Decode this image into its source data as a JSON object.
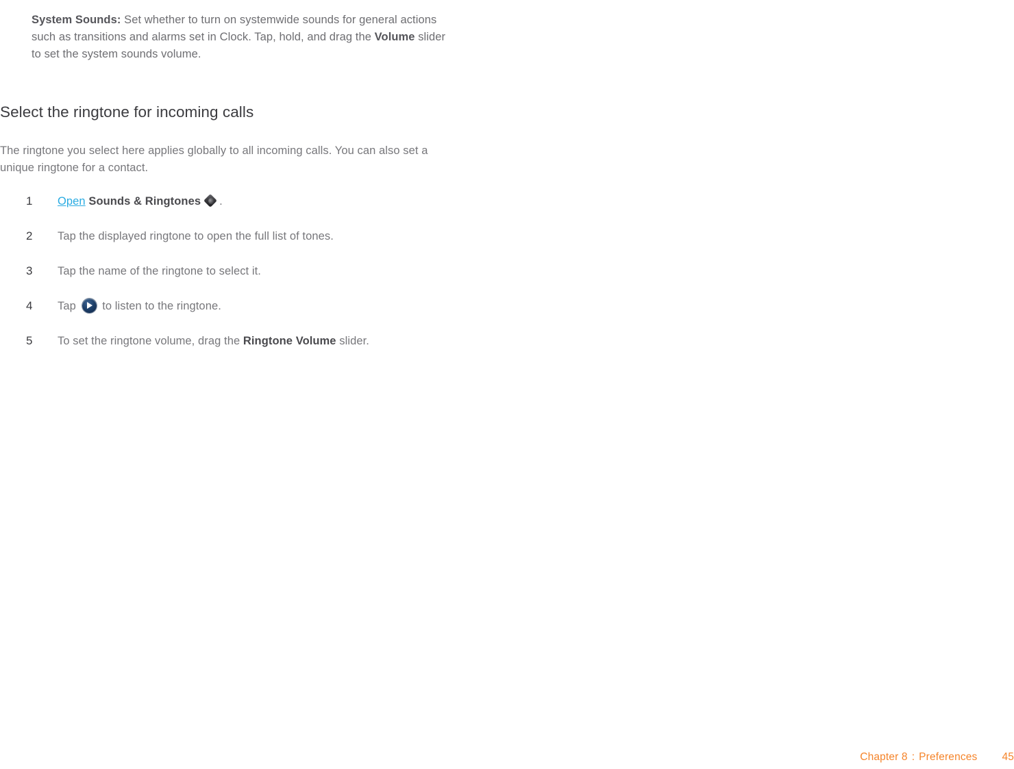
{
  "document": {
    "intro_paragraph": {
      "lead_bold": "System Sounds:",
      "body": " Set whether to turn on systemwide sounds for general actions such as transitions and alarms set in Clock. Tap, hold, and drag the ",
      "inline_bold": "Volume",
      "tail": " slider to set the system sounds volume."
    },
    "section_heading": "Select the ringtone for incoming calls",
    "lead_paragraph": "The ringtone you select here applies globally to all incoming calls. You can also set a unique ringtone for a contact.",
    "steps": [
      {
        "number": "1",
        "link_text": "Open",
        "bold_text": "Sounds & Ringtones",
        "icon": "sounds-ringtones-app-icon",
        "tail": "."
      },
      {
        "number": "2",
        "text": "Tap the displayed ringtone to open the full list of tones."
      },
      {
        "number": "3",
        "text": "Tap the name of the ringtone to select it."
      },
      {
        "number": "4",
        "prefix": "Tap",
        "icon": "play-button-icon",
        "suffix": "to listen to the ringtone."
      },
      {
        "number": "5",
        "prefix": "To set the ringtone volume, drag the ",
        "bold_text": "Ringtone Volume",
        "suffix": " slider."
      }
    ],
    "footer": {
      "chapter": "Chapter 8",
      "separator": ":",
      "section": "Preferences",
      "page_number": "45"
    },
    "colors": {
      "link": "#29abe2",
      "footer": "#f5842a",
      "body_text": "#77777b",
      "heading": "#3b3b3f"
    }
  }
}
